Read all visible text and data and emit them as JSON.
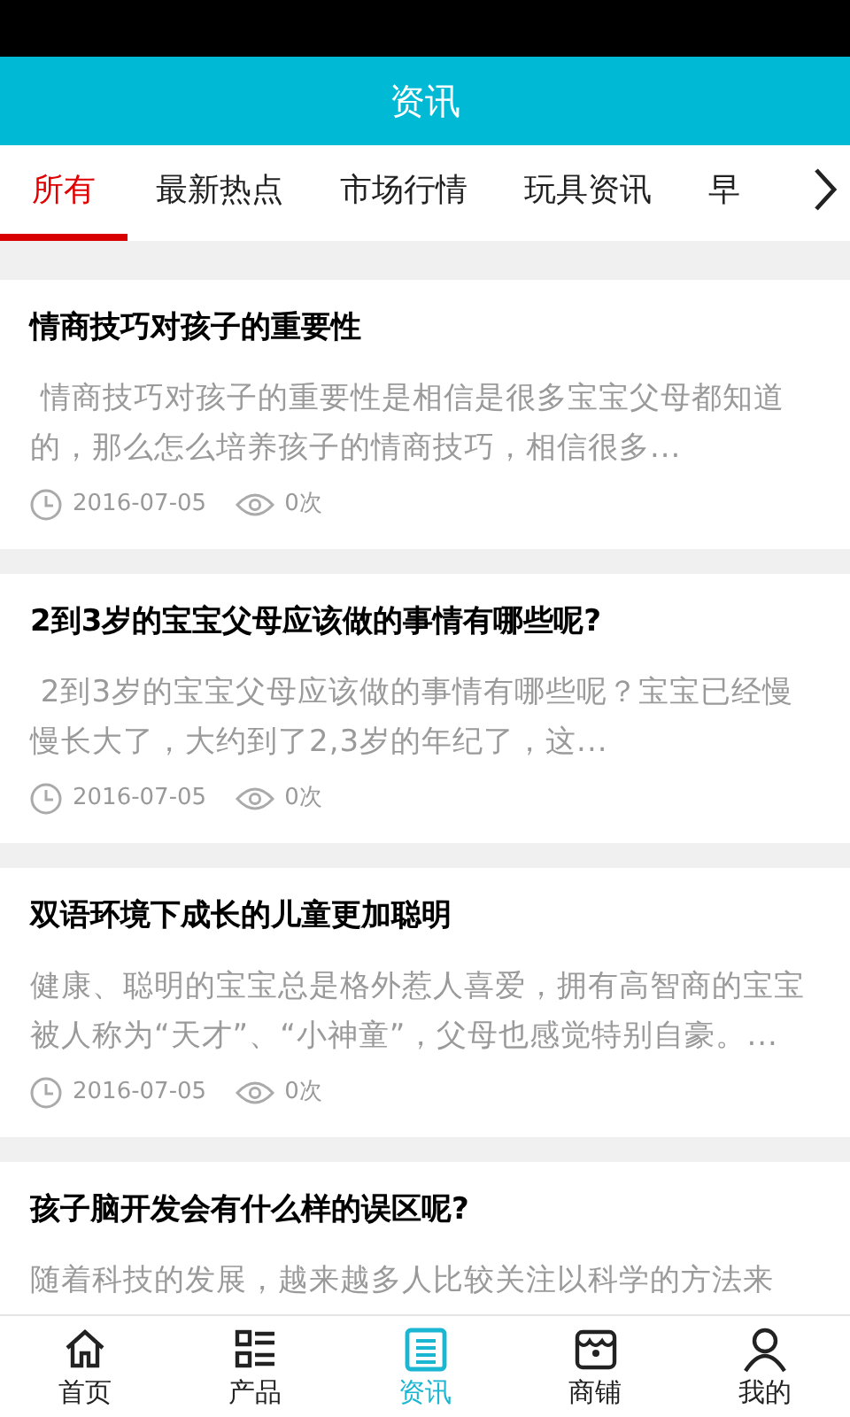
{
  "header": {
    "title": "资讯"
  },
  "tabs": [
    {
      "label": "所有",
      "selected": true
    },
    {
      "label": "最新热点",
      "selected": false
    },
    {
      "label": "市场行情",
      "selected": false
    },
    {
      "label": "玩具资讯",
      "selected": false
    },
    {
      "label": "早",
      "selected": false
    }
  ],
  "articles": [
    {
      "title": "情商技巧对孩子的重要性",
      "summary": " 情商技巧对孩子的重要性是相信是很多宝宝父母都知道的，那么怎么培养孩子的情商技巧，相信很多...",
      "date": "2016-07-05",
      "views": "0次"
    },
    {
      "title": "2到3岁的宝宝父母应该做的事情有哪些呢?",
      "summary": " 2到3岁的宝宝父母应该做的事情有哪些呢？宝宝已经慢慢长大了，大约到了2,3岁的年纪了，这...",
      "date": "2016-07-05",
      "views": "0次"
    },
    {
      "title": "双语环境下成长的儿童更加聪明",
      "summary": "健康、聪明的宝宝总是格外惹人喜爱，拥有高智商的宝宝被人称为“天才”、“小神童”，父母也感觉特别自豪。...",
      "date": "2016-07-05",
      "views": "0次"
    },
    {
      "title": "孩子脑开发会有什么样的误区呢?",
      "summary": "随着科技的发展，越来越多人比较关注以科学的方法来"
    }
  ],
  "bottom_nav": [
    {
      "label": "首页",
      "kind": "home",
      "selected": false
    },
    {
      "label": "产品",
      "kind": "list",
      "selected": false
    },
    {
      "label": "资讯",
      "kind": "news",
      "selected": true
    },
    {
      "label": "商铺",
      "kind": "shop",
      "selected": false
    },
    {
      "label": "我的",
      "kind": "user",
      "selected": false
    }
  ]
}
